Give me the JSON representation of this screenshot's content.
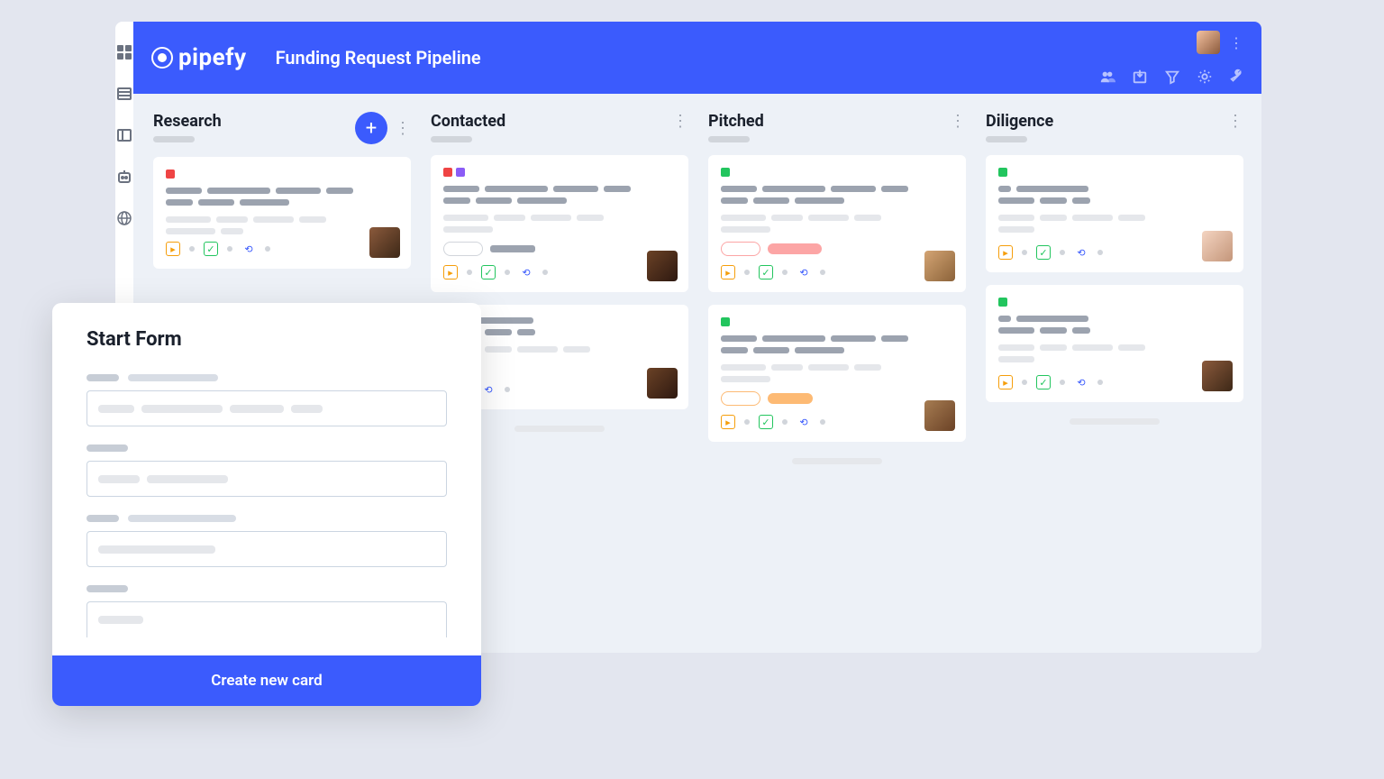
{
  "brand": "pipefy",
  "pipe_title": "Funding Request Pipeline",
  "columns": [
    {
      "title": "Research",
      "has_add": true
    },
    {
      "title": "Contacted",
      "has_add": false
    },
    {
      "title": "Pitched",
      "has_add": false
    },
    {
      "title": "Diligence",
      "has_add": false
    }
  ],
  "modal": {
    "title": "Start Form",
    "submit_label": "Create new card"
  },
  "colors": {
    "primary": "#3b5bfd",
    "label_red": "#ef4444",
    "label_green": "#22c55e",
    "label_purple": "#8b5cf6"
  }
}
